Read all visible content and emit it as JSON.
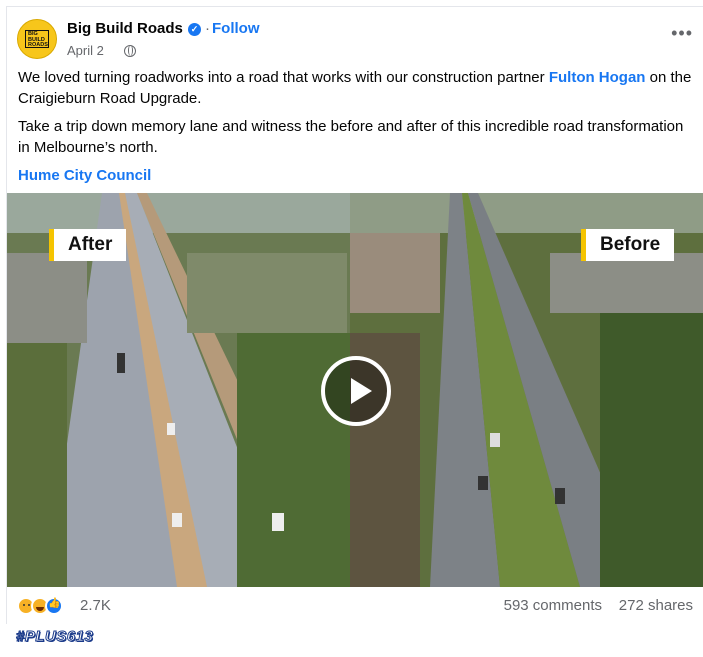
{
  "post": {
    "page_name": "Big Build Roads",
    "avatar_text": "BIG BUILD ROADS",
    "follow_label": "Follow",
    "date": "April 2",
    "paragraph1_prefix": "We loved turning roadworks into a road that works with our construction partner ",
    "paragraph1_link": "Fulton Hogan",
    "paragraph1_suffix": " on the Craigieburn Road Upgrade.",
    "paragraph2": "Take a trip down memory lane and witness the before and after of this incredible road transformation in Melbourne’s north.",
    "mention": "Hume City Council"
  },
  "video": {
    "label_after": "After",
    "label_before": "Before"
  },
  "footer": {
    "reaction_count": "2.7K",
    "comments": "593 comments",
    "shares": "272 shares"
  },
  "watermark": "#PLUS613",
  "icons": {
    "verified": "verified-badge-icon",
    "privacy": "globe-icon",
    "more": "more-options-icon",
    "play": "play-icon"
  },
  "colors": {
    "link": "#1877f2",
    "brand_yellow": "#f7c61b",
    "label_accent": "#f5c400"
  }
}
